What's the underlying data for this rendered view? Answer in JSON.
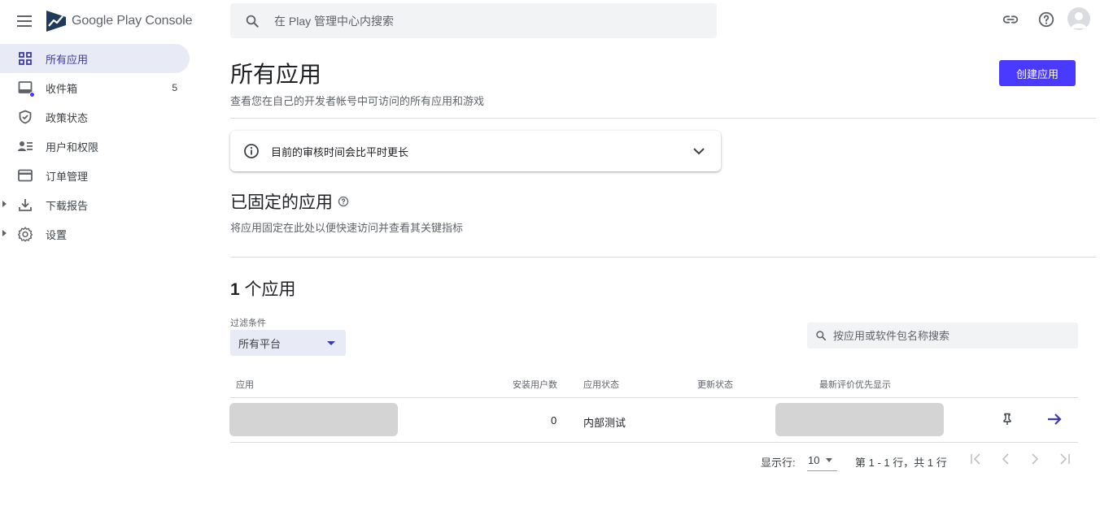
{
  "header": {
    "logo_text": "Google Play Console",
    "search_placeholder": "在 Play 管理中心内搜索"
  },
  "sidebar": {
    "items": [
      {
        "label": "所有应用",
        "icon": "grid-icon",
        "active": true
      },
      {
        "label": "收件箱",
        "icon": "inbox-icon",
        "count": "5"
      },
      {
        "label": "政策状态",
        "icon": "shield-icon"
      },
      {
        "label": "用户和权限",
        "icon": "users-icon"
      },
      {
        "label": "订单管理",
        "icon": "credit-card-icon"
      },
      {
        "label": "下载报告",
        "icon": "download-icon",
        "expandable": true
      },
      {
        "label": "设置",
        "icon": "gear-icon",
        "expandable": true
      }
    ]
  },
  "main": {
    "title": "所有应用",
    "subtitle": "查看您在自己的开发者帐号中可访问的所有应用和游戏",
    "create_button": "创建应用",
    "notice": "目前的审核时间会比平时更长",
    "pinned_title": "已固定的应用",
    "pinned_subtitle": "将应用固定在此处以便快速访问并查看其关键指标",
    "count_number": "1",
    "count_suffix": " 个应用",
    "filter_label": "过滤条件",
    "filter_value": "所有平台",
    "app_search_placeholder": "按应用或软件包名称搜索"
  },
  "table": {
    "headers": {
      "app": "应用",
      "installs": "安装用户数",
      "app_status": "应用状态",
      "update_status": "更新状态",
      "latest_rating": "最新评价优先显示"
    },
    "rows": [
      {
        "installs": "0",
        "app_status": "内部测试"
      }
    ]
  },
  "pagination": {
    "rows_label": "显示行:",
    "rows_value": "10",
    "range_text": "第 1 - 1 行，共 1 行"
  },
  "colors": {
    "accent": "#4a3aff",
    "active_bg": "#e8eaf6",
    "active_text": "#3d3ba8"
  }
}
